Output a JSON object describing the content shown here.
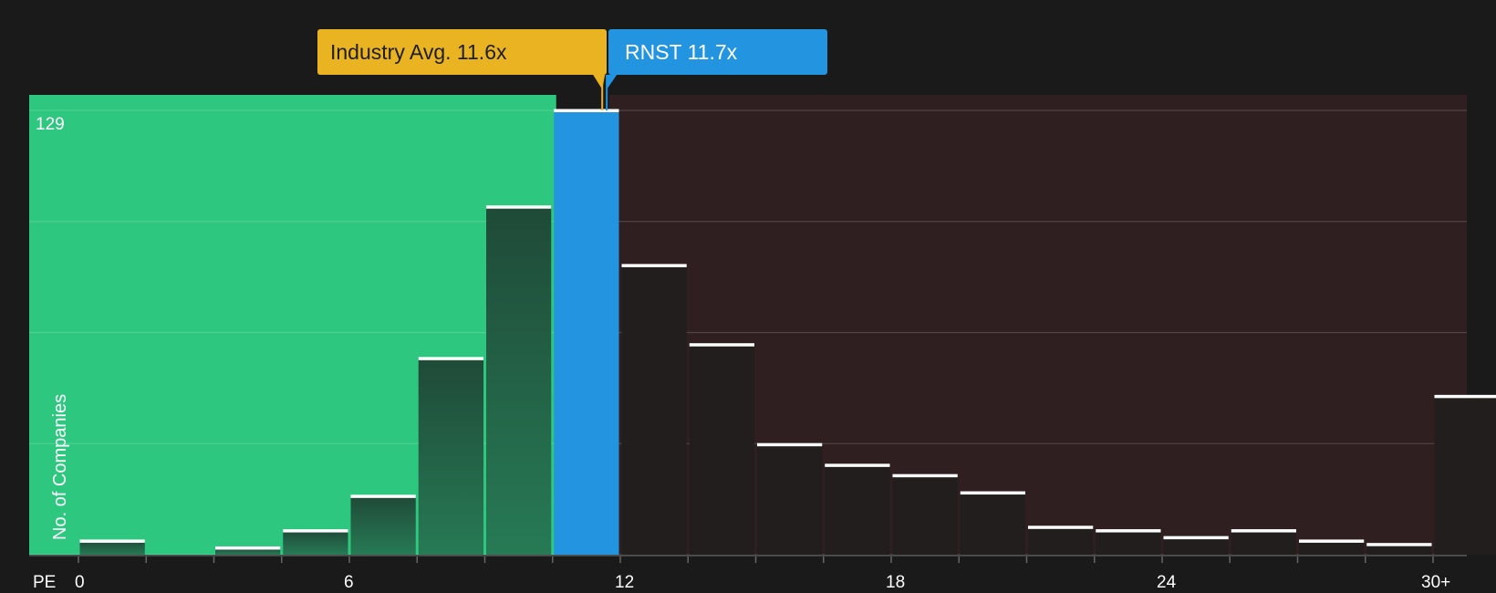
{
  "chart_data": {
    "type": "bar",
    "xlabel": "PE",
    "ylabel": "No. of Companies",
    "y_max_label": "129",
    "ylim": [
      0,
      129
    ],
    "xlim": [
      0,
      31
    ],
    "x_ticks": [
      "0",
      "6",
      "12",
      "18",
      "24",
      "30+"
    ],
    "bin_width": 1.5,
    "bars": [
      {
        "x0": 0,
        "value": 4
      },
      {
        "x0": 1.5,
        "value": 0
      },
      {
        "x0": 3,
        "value": 2
      },
      {
        "x0": 4.5,
        "value": 7
      },
      {
        "x0": 6,
        "value": 17
      },
      {
        "x0": 7.5,
        "value": 57
      },
      {
        "x0": 9,
        "value": 101
      },
      {
        "x0": 10.5,
        "value": 129,
        "highlight": true
      },
      {
        "x0": 12,
        "value": 84
      },
      {
        "x0": 13.5,
        "value": 61
      },
      {
        "x0": 15,
        "value": 32
      },
      {
        "x0": 16.5,
        "value": 26
      },
      {
        "x0": 18,
        "value": 23
      },
      {
        "x0": 19.5,
        "value": 18
      },
      {
        "x0": 21,
        "value": 8
      },
      {
        "x0": 22.5,
        "value": 7
      },
      {
        "x0": 24,
        "value": 5
      },
      {
        "x0": 25.5,
        "value": 7
      },
      {
        "x0": 27,
        "value": 4
      },
      {
        "x0": 28.5,
        "value": 3
      },
      {
        "x0": 30,
        "value": 46
      }
    ],
    "industry_avg": {
      "label": "Industry Avg. 11.6x",
      "value": 11.6
    },
    "company": {
      "label": "RNST 11.7x",
      "value": 11.7
    },
    "colors": {
      "background": "#1a1a1a",
      "undervalued": "#2ec77f",
      "overvalued": "#2f1f20",
      "highlight": "#2394df",
      "industry": "#e9b321"
    },
    "grid": true
  }
}
